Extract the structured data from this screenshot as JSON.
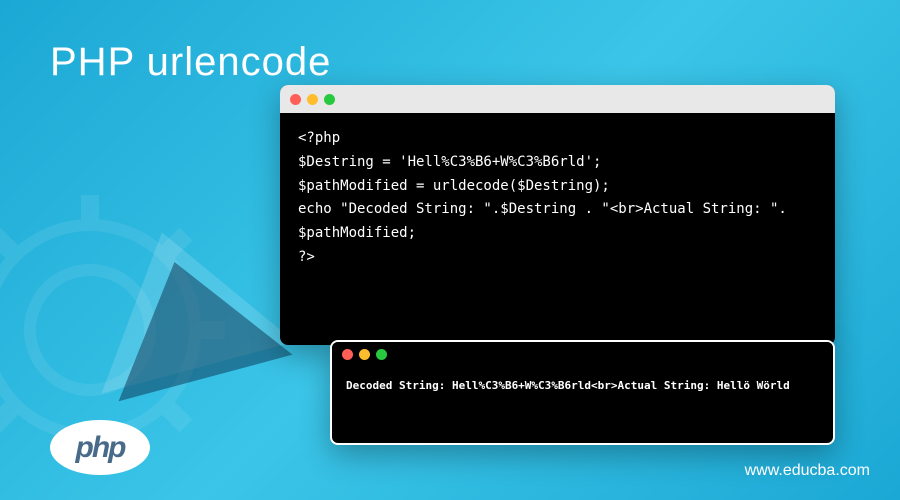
{
  "title": "PHP urlencode",
  "code_window_1": {
    "line1": "<?php",
    "line2": "$Destring = 'Hell%C3%B6+W%C3%B6rld';",
    "line3": "$pathModified = urldecode($Destring);",
    "line4": "echo \"Decoded String: \".$Destring . \"<br>Actual String: \". $pathModified;",
    "line5": "?>"
  },
  "code_window_2": {
    "output": "Decoded String: Hell%C3%B6+W%C3%B6rld<br>Actual String: Hellö Wörld"
  },
  "php_logo_text": "php",
  "site_url": "www.educba.com"
}
